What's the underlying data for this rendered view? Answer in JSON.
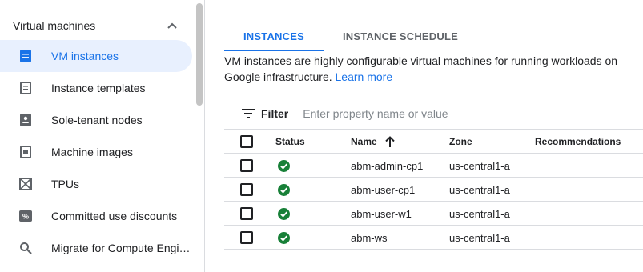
{
  "sidebar": {
    "section_title": "Virtual machines",
    "items": [
      {
        "label": "VM instances",
        "icon": "vm-instance-icon",
        "active": true
      },
      {
        "label": "Instance templates",
        "icon": "template-icon"
      },
      {
        "label": "Sole-tenant nodes",
        "icon": "sole-tenant-icon"
      },
      {
        "label": "Machine images",
        "icon": "machine-image-icon"
      },
      {
        "label": "TPUs",
        "icon": "tpu-icon"
      },
      {
        "label": "Committed use discounts",
        "icon": "discount-icon"
      },
      {
        "label": "Migrate for Compute Engi…",
        "icon": "search-icon"
      }
    ]
  },
  "tabs": [
    {
      "label": "INSTANCES",
      "active": true
    },
    {
      "label": "INSTANCE SCHEDULE",
      "active": false
    }
  ],
  "content": {
    "description": "VM instances are highly configurable virtual machines for running workloads on Google infrastructure.",
    "learn_more": "Learn more"
  },
  "filter": {
    "label": "Filter",
    "placeholder": "Enter property name or value"
  },
  "table": {
    "columns": {
      "status": "Status",
      "name": "Name",
      "zone": "Zone",
      "recommendations": "Recommendations"
    },
    "rows": [
      {
        "name": "abm-admin-cp1",
        "zone": "us-central1-a",
        "status": "running"
      },
      {
        "name": "abm-user-cp1",
        "zone": "us-central1-a",
        "status": "running"
      },
      {
        "name": "abm-user-w1",
        "zone": "us-central1-a",
        "status": "running"
      },
      {
        "name": "abm-ws",
        "zone": "us-central1-a",
        "status": "running"
      }
    ]
  },
  "colors": {
    "accent": "#1a73e8",
    "active_bg": "#e8f0fe",
    "success": "#188038"
  }
}
